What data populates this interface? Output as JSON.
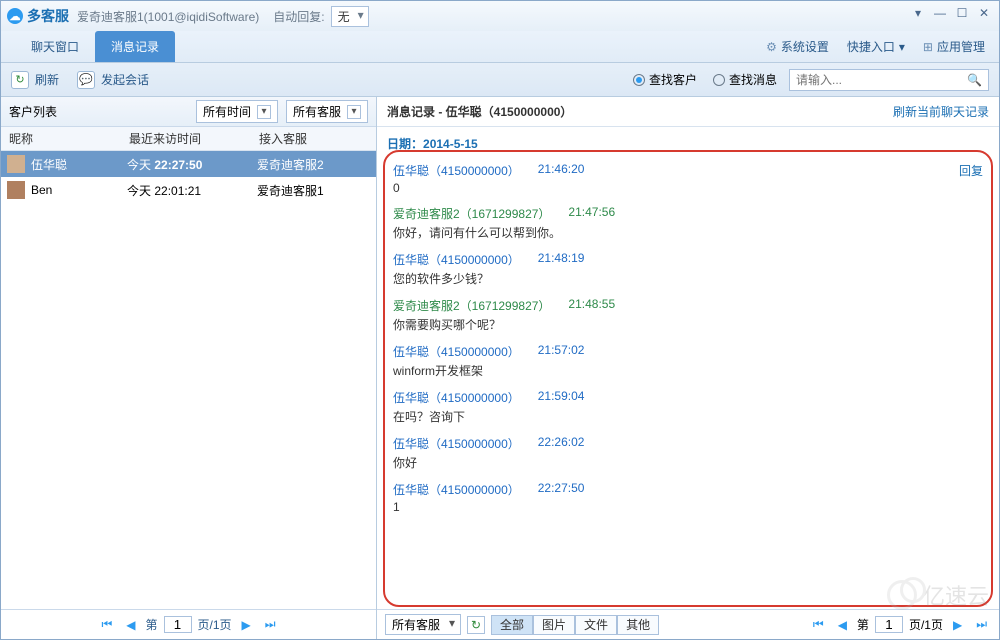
{
  "app": {
    "title": "多客服",
    "account": "爱奇迪客服1(1001@iqidiSoftware)",
    "auto_reply_lbl": "自动回复:",
    "auto_reply_val": "无"
  },
  "winctrl": {
    "dd": "▾",
    "min": "—",
    "max": "☐",
    "close": "✕"
  },
  "row2": {
    "tabs": [
      {
        "label": "聊天窗口"
      },
      {
        "label": "消息记录"
      }
    ],
    "sys_set": "系统设置",
    "quick_entry": "快捷入口",
    "app_mgr": "应用管理"
  },
  "toolbar": {
    "refresh": "刷新",
    "start_conv": "发起会话",
    "r1": "查找客户",
    "r2": "查找消息",
    "search_ph": "请输入..."
  },
  "left": {
    "title": "客户列表",
    "f_time": "所有时间",
    "f_agent": "所有客服",
    "cols": [
      "昵称",
      "最近来访时间",
      "接入客服"
    ],
    "rows": [
      {
        "name": "伍华聪",
        "time_pre": "今天 ",
        "time": "22:27:50",
        "agent": "爱奇迪客服2"
      },
      {
        "name": "Ben",
        "time_pre": "今天 ",
        "time": "22:01:21",
        "agent": "爱奇迪客服1"
      }
    ],
    "page_word_pre": "第",
    "page_word_suf": "页/1页",
    "page_val": "1"
  },
  "right": {
    "title_pre": "消息记录 - ",
    "title_name": "伍华聪（4150000000）",
    "refresh_link": "刷新当前聊天记录",
    "date_lbl": "日期：",
    "date_val": "2014-5-15",
    "reply": "回复",
    "msgs": [
      {
        "who": "a",
        "name": "伍华聪（4150000000）",
        "time": "21:46:20",
        "body": "0",
        "reply": true
      },
      {
        "who": "b",
        "name": "爱奇迪客服2（1671299827）",
        "time": "21:47:56",
        "body": "你好，请问有什么可以帮到你。"
      },
      {
        "who": "a",
        "name": "伍华聪（4150000000）",
        "time": "21:48:19",
        "body": "您的软件多少钱？"
      },
      {
        "who": "b",
        "name": "爱奇迪客服2（1671299827）",
        "time": "21:48:55",
        "body": "你需要购买哪个呢？"
      },
      {
        "who": "a",
        "name": "伍华聪（4150000000）",
        "time": "21:57:02",
        "body": "winform开发框架"
      },
      {
        "who": "a",
        "name": "伍华聪（4150000000）",
        "time": "21:59:04",
        "body": "在吗？咨询下"
      },
      {
        "who": "a",
        "name": "伍华聪（4150000000）",
        "time": "22:26:02",
        "body": "你好"
      },
      {
        "who": "a",
        "name": "伍华聪（4150000000）",
        "time": "22:27:50",
        "body": "1"
      }
    ],
    "bot_agent": "所有客服",
    "filters": [
      "全部",
      "图片",
      "文件",
      "其他"
    ],
    "page_word_pre": "第",
    "page_word_suf": "页/1页",
    "page_val": "1"
  },
  "watermark": "亿速云"
}
